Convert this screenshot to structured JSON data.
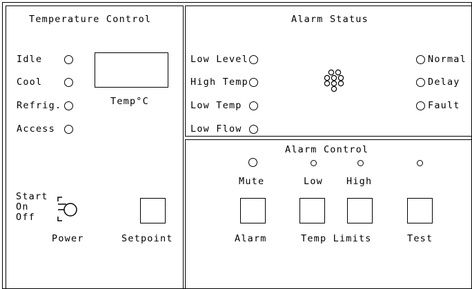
{
  "temperature_control": {
    "title": "Temperature Control",
    "indicators": [
      {
        "label": "Idle"
      },
      {
        "label": "Cool"
      },
      {
        "label": "Refrig."
      },
      {
        "label": "Access"
      }
    ],
    "display_label": "Temp°C",
    "power_positions": {
      "start": "Start",
      "on": "On",
      "off": "Off"
    },
    "power_label": "Power",
    "setpoint_label": "Setpoint"
  },
  "alarm_status": {
    "title": "Alarm Status",
    "left_indicators": [
      {
        "label": "Low Level"
      },
      {
        "label": "High Temp"
      },
      {
        "label": "Low Temp"
      },
      {
        "label": "Low Flow"
      }
    ],
    "right_indicators": [
      {
        "label": "Normal"
      },
      {
        "label": "Delay"
      },
      {
        "label": "Fault"
      }
    ],
    "buzzer_icon": "speaker-grille-icon"
  },
  "alarm_control": {
    "title": "Alarm Control",
    "led_labels": {
      "mute": "Mute",
      "low": "Low",
      "high": "High"
    },
    "button_labels": {
      "alarm": "Alarm",
      "temp_limits": "Temp Limits",
      "test": "Test"
    }
  }
}
